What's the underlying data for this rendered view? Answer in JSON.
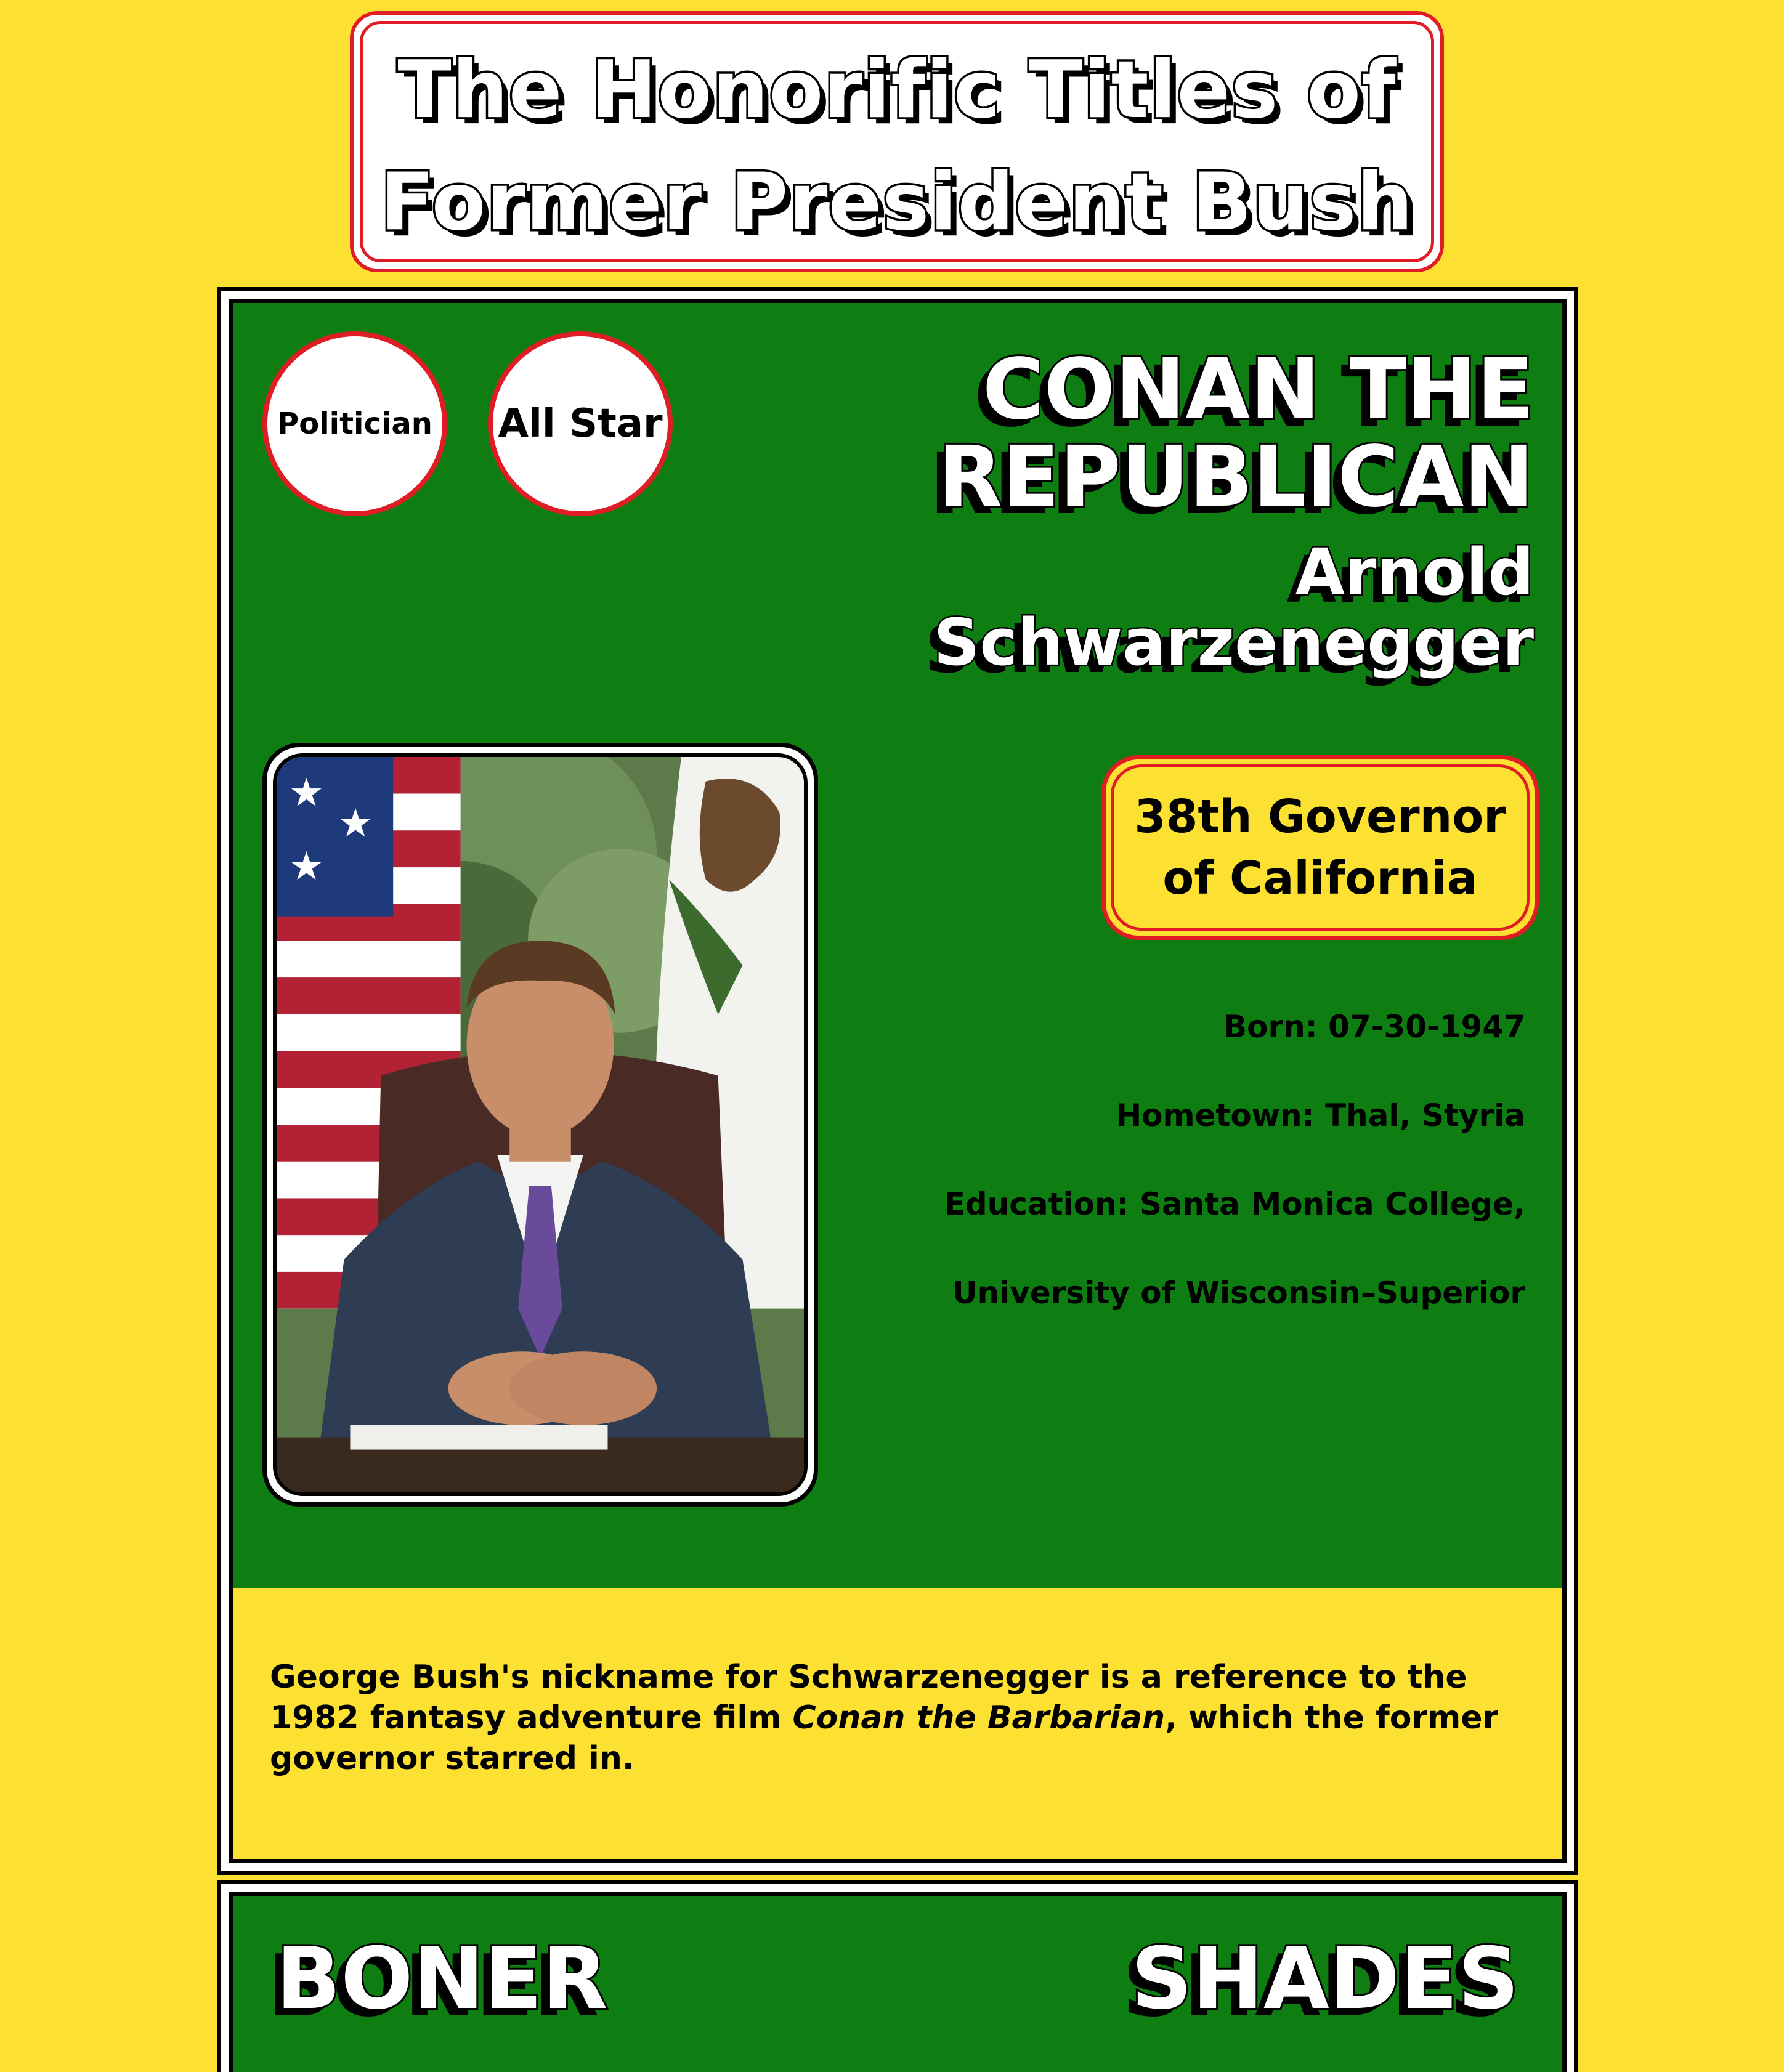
{
  "header": {
    "title_line1": "The Honorific Titles of",
    "title_line2": "Former President Bush"
  },
  "card": {
    "badges": [
      "Politician",
      "All Star"
    ],
    "nickname_line1": "CONAN THE",
    "nickname_line2": "REPUBLICAN",
    "name_line1": "Arnold",
    "name_line2": "Schwarzenegger",
    "office_line1": "38th Governor",
    "office_line2": "of California",
    "facts": [
      "Born: 07-30-1947",
      "Hometown: Thal, Styria",
      "Education: Santa Monica College,",
      "University of Wisconsin–Superior"
    ],
    "description_before": "George Bush's nickname for Schwarzenegger is a reference to the 1982 fantasy adventure film ",
    "description_film": "Conan the Barbarian",
    "description_after": ", which the former governor starred in."
  },
  "footer": {
    "left_label": "BONER",
    "right_label": "SHADES"
  },
  "colors": {
    "background": "#fce133",
    "card_green": "#0e7e13",
    "accent_red": "#e01c24"
  }
}
